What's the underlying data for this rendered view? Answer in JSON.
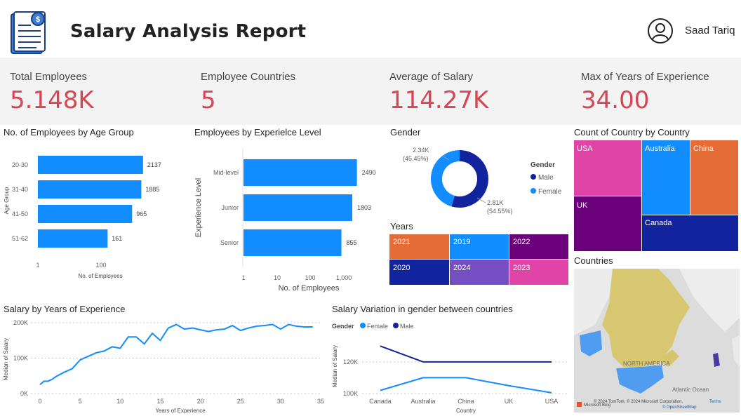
{
  "header": {
    "title": "Salary Analysis Report",
    "user_name": "Saad Tariq"
  },
  "kpis": [
    {
      "label": "Total Employees",
      "value": "5.148K"
    },
    {
      "label": "Employee Countries",
      "value": "5"
    },
    {
      "label": "Average of Salary",
      "value": "114.27K"
    },
    {
      "label": "Max of Years of Experience",
      "value": "34.00"
    }
  ],
  "colors": {
    "accent": "#d64550",
    "bar": "#118dff",
    "dark": "#12239e",
    "orange": "#e66c37",
    "purple": "#6b007b",
    "pink": "#e044a7",
    "violet": "#744ec2"
  },
  "chart_data": [
    {
      "id": "age",
      "type": "bar",
      "orientation": "horizontal",
      "title": "No. of Employees by Age Group",
      "xlabel": "No. of Employees",
      "ylabel": "Age Group",
      "x_scale": "log",
      "x_ticks": [
        "1",
        "100"
      ],
      "categories": [
        "20-30",
        "31-40",
        "41-50",
        "51-62"
      ],
      "values": [
        2137,
        1885,
        965,
        161
      ],
      "labels": [
        "2137",
        "1885",
        "965",
        "161"
      ]
    },
    {
      "id": "exp",
      "type": "bar",
      "orientation": "horizontal",
      "title": "Employees by Experielce Level",
      "xlabel": "No. of Employees",
      "ylabel": "Experience Level",
      "x_scale": "log",
      "x_ticks": [
        "1",
        "10",
        "100",
        "1,000"
      ],
      "categories": [
        "Mid-level",
        "Junior",
        "Senior"
      ],
      "values": [
        2490,
        1803,
        855
      ],
      "labels": [
        "2490",
        "1803",
        "855"
      ]
    },
    {
      "id": "gender",
      "type": "pie",
      "title": "Gender",
      "legend_title": "Gender",
      "legend_position": "right",
      "slices": [
        {
          "name": "Male",
          "value": 2810,
          "label": "2.81K",
          "pct": "(54.55%)"
        },
        {
          "name": "Female",
          "value": 2340,
          "label": "2.34K",
          "pct": "(45.45%)"
        }
      ]
    },
    {
      "id": "years",
      "type": "heatmap",
      "title": "Years",
      "tiles": [
        "2021",
        "2019",
        "2022",
        "2020",
        "2024",
        "2023"
      ]
    },
    {
      "id": "country",
      "type": "heatmap",
      "title": "Count of Country by Country",
      "tiles": [
        "USA",
        "Australia",
        "China",
        "UK",
        "Canada"
      ]
    },
    {
      "id": "salary_exp",
      "type": "line",
      "title": "Salary by Years of Experience",
      "xlabel": "Years of Experience",
      "ylabel": "Median of Salary",
      "x_ticks": [
        "0",
        "5",
        "10",
        "15",
        "20",
        "25",
        "30",
        "35"
      ],
      "y_ticks": [
        "0K",
        "100K",
        "200K"
      ],
      "ylim": [
        0,
        200000
      ],
      "xlim": [
        -1,
        35
      ],
      "x": [
        0,
        0.5,
        1,
        1.5,
        2,
        3,
        4,
        5,
        6,
        7,
        8,
        9,
        10,
        11,
        12,
        13,
        14,
        15,
        16,
        17,
        18,
        19,
        20,
        21,
        22,
        23,
        24,
        25,
        26,
        27,
        28,
        29,
        30,
        31,
        32,
        33,
        34
      ],
      "y": [
        25000,
        35000,
        35000,
        40000,
        48000,
        60000,
        70000,
        95000,
        105000,
        115000,
        120000,
        132000,
        128000,
        160000,
        160000,
        140000,
        170000,
        150000,
        185000,
        195000,
        182000,
        185000,
        180000,
        175000,
        180000,
        182000,
        192000,
        178000,
        185000,
        190000,
        192000,
        195000,
        182000,
        195000,
        190000,
        188000,
        188000
      ]
    },
    {
      "id": "salary_gender",
      "type": "line",
      "title": "Salary Variation in gender between countries",
      "legend_title": "Gender",
      "legend_position": "top-left",
      "xlabel": "Country",
      "ylabel": "Median of Salary",
      "categories": [
        "Canada",
        "Australia",
        "China",
        "UK",
        "USA"
      ],
      "y_ticks": [
        "100K",
        "120K"
      ],
      "ylim": [
        100000,
        135000
      ],
      "series": [
        {
          "name": "Female",
          "values": [
            102000,
            110000,
            110000,
            105000,
            100500
          ]
        },
        {
          "name": "Male",
          "values": [
            130000,
            120000,
            120000,
            120000,
            120000
          ]
        }
      ]
    }
  ],
  "map": {
    "title": "Countries",
    "region_label": "NORTH AMERICA",
    "ocean_label": "Atlantic Ocean",
    "attribution": "© 2024 TomTom, © 2024 Microsoft Corporation,",
    "terms": "Terms",
    "osm": "© OpenStreetMap",
    "bing": "Microsoft Bing"
  }
}
